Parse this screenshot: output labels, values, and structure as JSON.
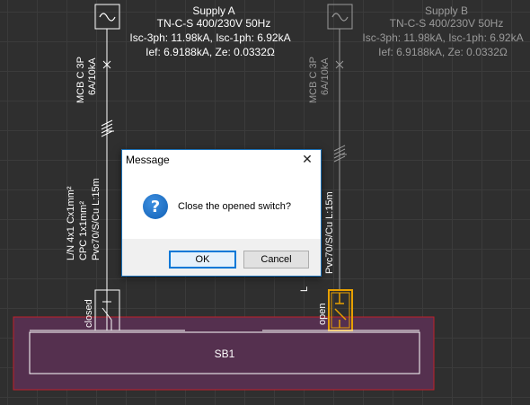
{
  "supply_a": {
    "title": "Supply A",
    "network": "TN-C-S 400/230V 50Hz",
    "isc": "Isc-3ph: 11.98kA, Isc-1ph: 6.92kA",
    "ief": "Ief: 6.9188kA, Ze: 0.0332Ω",
    "breaker_type": "MCB C 3P",
    "breaker_rating": "6A/10kA",
    "cable_line1": "L/N 4x1 Cx1mm²",
    "cable_line2": "CPC 1x1mm²",
    "cable_line3": "Pvc70/S/Cu L:15m",
    "switch_state": "closed"
  },
  "supply_b": {
    "title": "Supply B",
    "network": "TN-C-S 400/230V 50Hz",
    "isc": "Isc-3ph: 11.98kA, Isc-1ph: 6.92kA",
    "ief": "Ief: 6.9188kA, Ze: 0.0332Ω",
    "breaker_type": "MCB C 3P",
    "breaker_rating": "6A/10kA",
    "cable_partial": "Pvc70/S/Cu L:15m",
    "cable_fragment": "L",
    "switch_state": "open"
  },
  "busbar": {
    "label": "SB1"
  },
  "colors": {
    "background": "#2f2f2f",
    "grid": "#3b3b3b",
    "line_active": "#ffffff",
    "line_dim": "#9a9a9a",
    "selection_fill": "#55304f",
    "selection_border": "#c0202a",
    "switch_open": "#e8a000"
  },
  "dialog": {
    "title": "Message",
    "close_glyph": "✕",
    "message": "Close the opened switch?",
    "icon": "question-icon",
    "ok_label": "OK",
    "cancel_label": "Cancel"
  }
}
